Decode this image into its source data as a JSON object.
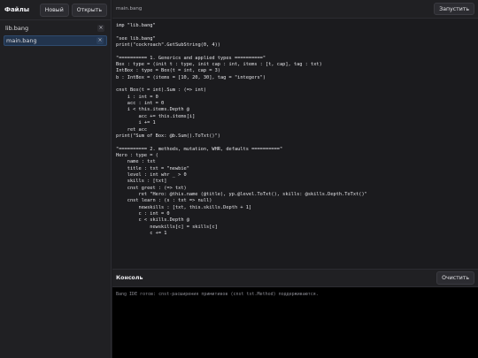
{
  "sidebar": {
    "title": "Файлы",
    "new_label": "Новый",
    "open_label": "Открыть",
    "files": [
      {
        "name": "lib.bang",
        "close": "×",
        "active": false
      },
      {
        "name": "main.bang",
        "close": "×",
        "active": true
      }
    ]
  },
  "editor": {
    "tab_name": "main.bang",
    "run_label": "Запустить",
    "code": "imp \"lib.bang\"\n\n\"see lib.bang\"\nprint(\"cockroach\".GetSubString(0, 4))\n\n\"========== 1. Generics and applied types ==========\"\nBox : type = (init t : type, init cap : int, items : [t, cap], tag : txt)\nIntBox : type = Box(t = int, cap = 3)\nb : IntBox = (items = [10, 20, 30], tag = \"integers\")\n\ncnst Box(t = int).Sum : (=> int)\n    i : int = 0\n    acc : int = 0\n    i < this.items.Depth @\n        acc += this.items[i]\n        i += 1\n    ret acc\nprint(\"Sum of Box: @b.Sum().ToTxt()\")\n\n\"========== 2. methods, mutation, WHR, defaults ==========\"\nHero : type = (\n    name : txt\n    title : txt = \"newbie\"\n    level : int whr _ > 0\n    skills : [txt]\n    cnst greet : (=> txt)\n        ret \"Hero: @this.name (@title), yp.@level.ToTxt(), skills: @skills.Depth.ToTxt()\"\n    cnst learn : (s : txt => null)\n        newskills : [txt, this.skills.Depth + 1]\n        c : int = 0\n        c < skills.Depth @\n            newskills[c] = skills[c]\n            c += 1"
  },
  "console": {
    "title": "Консоль",
    "clear_label": "Очистить",
    "lines": [
      "Bang IDE готов: cnst-расширения примитивов (cnst txt.Method) поддерживаются."
    ]
  },
  "colors": {
    "background": "#1c1c1f",
    "panel": "#202023",
    "editor_bg": "#1b1b1e",
    "console_bg": "#000000",
    "active_file": "#22344d"
  }
}
